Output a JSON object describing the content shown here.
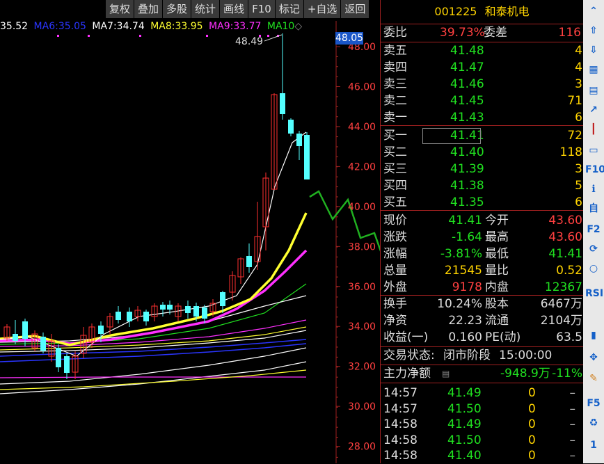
{
  "toolbar": {
    "items": [
      "复权",
      "叠加",
      "多股",
      "统计",
      "画线",
      "F10",
      "标记",
      "+自选",
      "返回"
    ]
  },
  "ma_legend": {
    "ma5_value": "35.52",
    "ma6_label": "MA6:",
    "ma6_value": "35.05",
    "ma7_label": "MA7:",
    "ma7_value": "34.74",
    "ma8_label": "MA8:",
    "ma8_value": "33.95",
    "ma9_label": "MA9:",
    "ma9_value": "33.77",
    "ma10_label": "MA10",
    "colors": {
      "ma5": "#ffffff",
      "ma6": "#2a35ff",
      "ma7": "#ffffff",
      "ma8": "#ffff30",
      "ma9": "#ff30ff",
      "ma10": "#20e020"
    }
  },
  "price_axis": {
    "ticks": [
      "48.00",
      "46.00",
      "44.00",
      "42.00",
      "40.00",
      "38.00",
      "36.00",
      "34.00",
      "32.00",
      "30.00",
      "28.00"
    ],
    "current_tag": "48.05"
  },
  "high_annotation": "48.49",
  "stock": {
    "code": "001225",
    "name": "和泰机电"
  },
  "commit": {
    "ratio_label": "委比",
    "ratio_value": "39.73%",
    "diff_label": "委差",
    "diff_value": "116"
  },
  "sell": [
    {
      "label": "卖五",
      "price": "41.48",
      "vol": "4"
    },
    {
      "label": "卖四",
      "price": "41.47",
      "vol": "4"
    },
    {
      "label": "卖三",
      "price": "41.46",
      "vol": "3"
    },
    {
      "label": "卖二",
      "price": "41.45",
      "vol": "71"
    },
    {
      "label": "卖一",
      "price": "41.43",
      "vol": "6"
    }
  ],
  "buy": [
    {
      "label": "买一",
      "price": "41.41",
      "vol": "72"
    },
    {
      "label": "买二",
      "price": "41.40",
      "vol": "118"
    },
    {
      "label": "买三",
      "price": "41.39",
      "vol": "3"
    },
    {
      "label": "买四",
      "price": "41.38",
      "vol": "5"
    },
    {
      "label": "买五",
      "price": "41.35",
      "vol": "6"
    }
  ],
  "stats": [
    {
      "l1": "现价",
      "v1": "41.41",
      "l2": "今开",
      "v2": "43.60"
    },
    {
      "l1": "涨跌",
      "v1": "-1.64",
      "l2": "最高",
      "v2": "43.60"
    },
    {
      "l1": "涨幅",
      "v1": "-3.81%",
      "l2": "最低",
      "v2": "41.41"
    },
    {
      "l1": "总量",
      "v1": "21545",
      "l2": "量比",
      "v2": "0.52"
    },
    {
      "l1": "外盘",
      "v1": "9178",
      "l2": "内盘",
      "v2": "12367"
    }
  ],
  "fund": [
    {
      "l1": "换手",
      "v1": "10.24%",
      "l2": "股本",
      "v2": "6467万"
    },
    {
      "l1": "净资",
      "v1": "22.23",
      "l2": "流通",
      "v2": "2104万"
    },
    {
      "l1": "收益(一)",
      "v1": "0.160",
      "l2": "PE(动)",
      "v2": "63.5"
    }
  ],
  "status": {
    "label": "交易状态:",
    "value": "闭市阶段",
    "time": "15:00:00"
  },
  "main_net": {
    "label": "主力净额",
    "amount": "-948.9万",
    "pct": "-11%"
  },
  "ticks": [
    {
      "time": "14:57",
      "price": "41.49",
      "vol": "0",
      "flag": "–"
    },
    {
      "time": "14:57",
      "price": "41.50",
      "vol": "0",
      "flag": "–"
    },
    {
      "time": "14:58",
      "price": "41.49",
      "vol": "0",
      "flag": "–"
    },
    {
      "time": "14:58",
      "price": "41.50",
      "vol": "0",
      "flag": "–"
    },
    {
      "time": "14:58",
      "price": "41.40",
      "vol": "0",
      "flag": "–"
    }
  ],
  "sidebar": {
    "icons": [
      "chevron-up-icon",
      "arrow-up-icon",
      "arrow-down-icon",
      "table-icon",
      "list-icon",
      "line-chart-icon",
      "candle-icon",
      "quote-icon",
      "f10-icon",
      "info-icon",
      "self-select-icon",
      "f2-icon",
      "refresh-icon",
      "cycle-icon",
      "rsi-icon",
      "stock-icon",
      "move-icon",
      "pen-icon",
      "f5-icon",
      "recycle-icon",
      "one-icon"
    ],
    "labels": {
      "f10": "F10",
      "rsi": "RSI",
      "f5": "F5",
      "one": "1"
    }
  }
}
